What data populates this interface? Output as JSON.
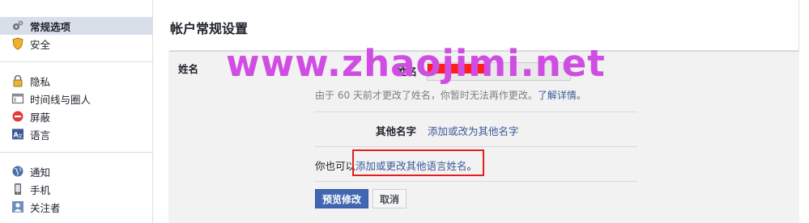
{
  "sidebar": {
    "groups": [
      [
        {
          "label": "常规选项",
          "icon": "gears-icon",
          "active": true
        },
        {
          "label": "安全",
          "icon": "shield-icon"
        }
      ],
      [
        {
          "label": "隐私",
          "icon": "lock-icon"
        },
        {
          "label": "时间线与圈人",
          "icon": "timeline-icon"
        },
        {
          "label": "屏蔽",
          "icon": "block-icon"
        },
        {
          "label": "语言",
          "icon": "language-icon"
        }
      ],
      [
        {
          "label": "通知",
          "icon": "globe-icon"
        },
        {
          "label": "手机",
          "icon": "mobile-icon"
        },
        {
          "label": "关注者",
          "icon": "followers-icon"
        }
      ]
    ]
  },
  "main": {
    "title": "帐户常规设置",
    "section_label": "姓名",
    "name_field_label": "姓名",
    "note_text": "由于 60 天前才更改了姓名，你暂时无法再作更改。",
    "note_link": "了解详情。",
    "alt_names_label": "其他名字",
    "alt_names_link": "添加或改为其他名字",
    "lang_prefix": "你也可以",
    "lang_link": "添加或更改其他语言姓名",
    "lang_suffix": "。",
    "preview_button": "预览修改",
    "cancel_button": "取消"
  },
  "watermark": "www.zhaojimi.net",
  "colors": {
    "link": "#3b5998",
    "primary_button": "#4267b2",
    "active_item_bg": "#d8dfea",
    "highlight_box": "#e02020",
    "watermark": "#cf4de3",
    "redaction": "#ff1f1f"
  }
}
